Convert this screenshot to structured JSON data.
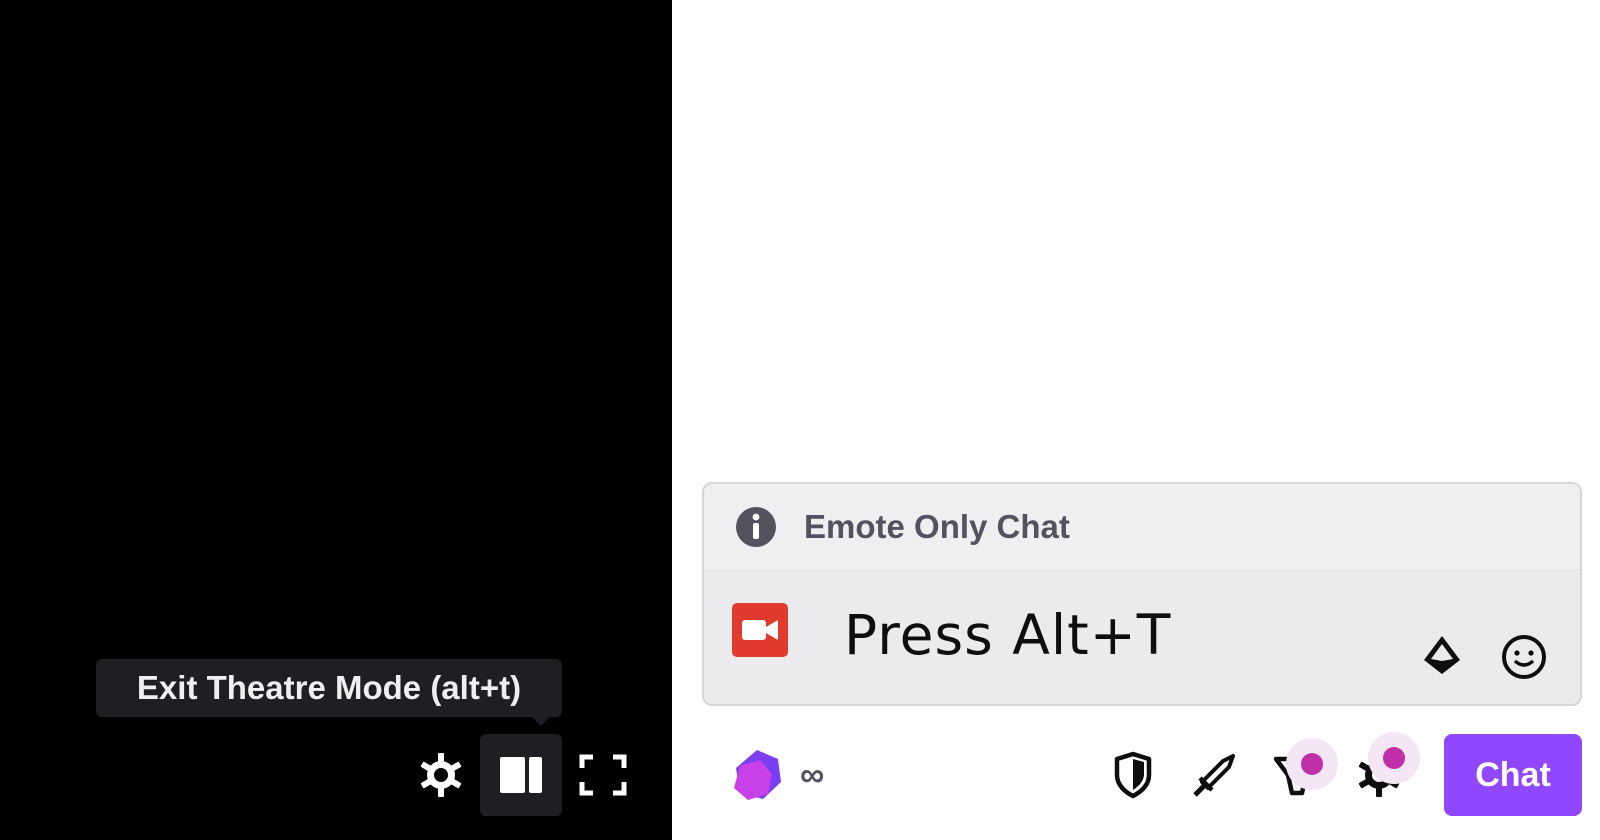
{
  "player": {
    "tooltip": "Exit Theatre Mode (alt+t)",
    "controls": [
      {
        "name": "settings",
        "icon": "gear-icon"
      },
      {
        "name": "theatre-mode",
        "icon": "theatre-mode-icon",
        "active": true
      },
      {
        "name": "fullscreen",
        "icon": "fullscreen-icon"
      }
    ]
  },
  "chat": {
    "notice": "Emote Only Chat",
    "message": "Press Alt+T",
    "channel_points": "∞",
    "chat_button": "Chat",
    "toolbar_icons": [
      "shield-icon",
      "sword-icon",
      "prediction-icon",
      "gear-icon"
    ]
  },
  "colors": {
    "accent": "#9147ff",
    "notification_dot": "#bf2fa8",
    "camera": "#e03b2c"
  }
}
